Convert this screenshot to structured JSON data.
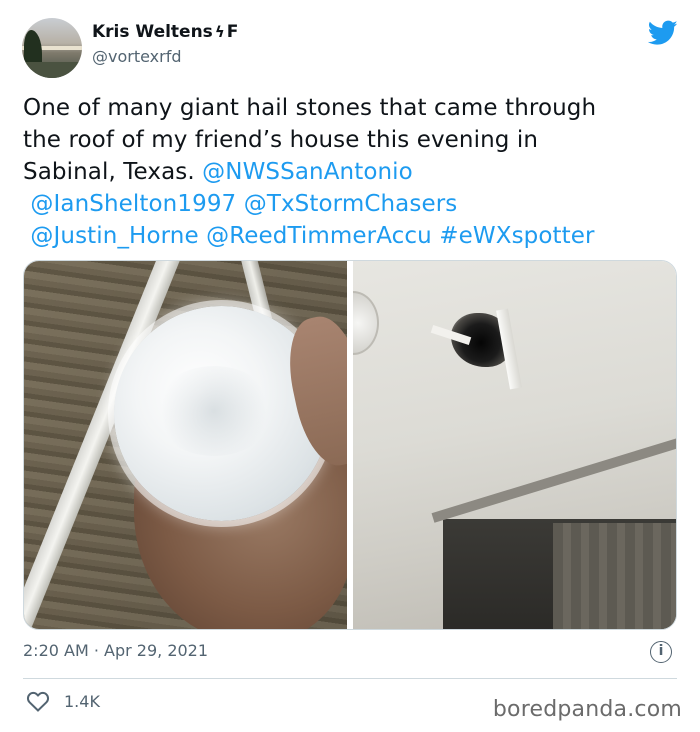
{
  "author": {
    "display_name": "Kris Weltens",
    "bolt_glyph": "ϟ",
    "suffix": "F",
    "handle": "@vortexrfd"
  },
  "tweet": {
    "line1": "One of many giant hail stones that came through",
    "line2": "the roof of my friend’s house this evening in",
    "line3_text": "Sabinal, Texas. ",
    "mention_nws": "@NWSSanAntonio",
    "mention_ian": "@IanShelton1997",
    "mention_tx": "@TxStormChasers",
    "mention_justin": "@Justin_Horne",
    "mention_reed": "@ReedTimmerAccu",
    "hashtag": "#eWXspotter"
  },
  "meta": {
    "timestamp": "2:20 AM · Apr 29, 2021",
    "info_glyph": "i"
  },
  "footer": {
    "like_count": "1.4K",
    "watermark": "boredpanda.com"
  },
  "icons": {
    "twitter_logo": "twitter-bird-icon",
    "heart": "heart-outline-icon",
    "info": "info-circle-icon"
  },
  "colors": {
    "link": "#1d9bf0",
    "secondary_text": "#536471",
    "twitter_blue": "#1d9bf0"
  }
}
